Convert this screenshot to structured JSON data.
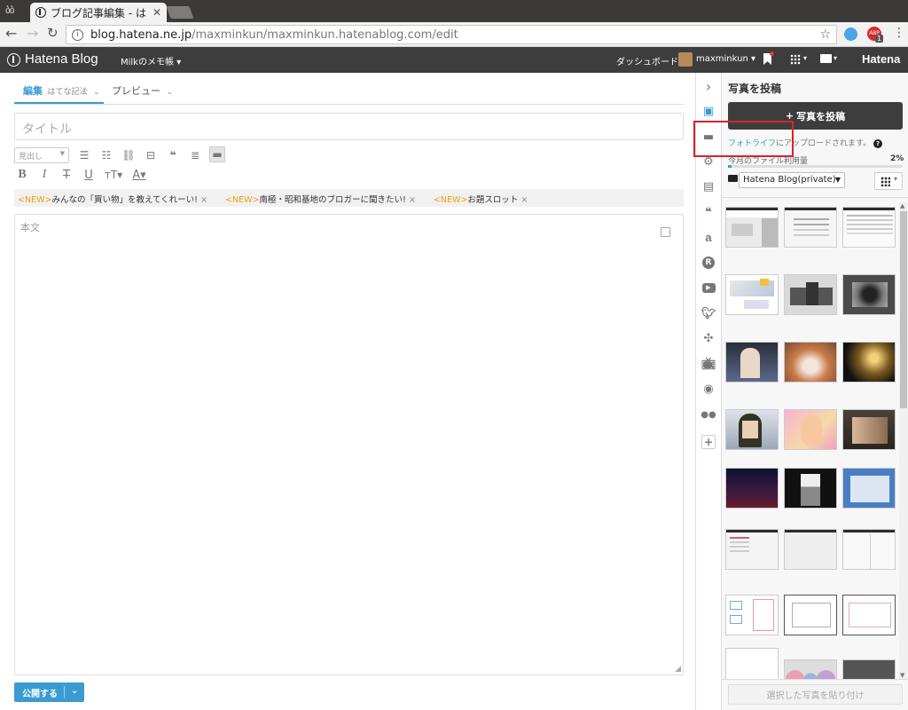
{
  "browser": {
    "tab_title": "ブログ記事編集 - は",
    "url_domain": "blog.hatena.ne.jp",
    "url_path": "/maxminkun/maxminkun.hatenablog.com/edit",
    "ext_badge": "1",
    "ext_abp": "ABP"
  },
  "header": {
    "logo": "Hatena Blog",
    "blog_menu": "Milkのメモ帳 ▾",
    "dashboard": "ダッシュボード",
    "username": "maxminkun ▾",
    "hatena": "Hatena"
  },
  "editor": {
    "tab_edit": "編集",
    "tab_edit_mode": "はてな記法",
    "tab_preview": "プレビュー",
    "title_placeholder": "タイトル",
    "heading_select": "見出し",
    "body_placeholder": "本文",
    "topics": [
      {
        "tag": "<NEW>",
        "text": "みんなの「買い物」を教えてくれーい!"
      },
      {
        "tag": "<NEW>",
        "text": "南極・昭和基地のブロガーに聞きたい!"
      },
      {
        "tag": "<NEW>",
        "text": "お題スロット"
      }
    ],
    "publish_button": "公開する"
  },
  "panel": {
    "title": "写真を投稿",
    "upload_button": "写真を投稿",
    "fotolife_link": "フォトライフ",
    "fotolife_text": "にアップロードされます。",
    "usage_label": "今月のファイル利用量",
    "usage_value": "2%",
    "usage_fraction": 0.02,
    "folder": "Hatena Blog(private)",
    "paste_button": "選択した写真を貼り付け"
  },
  "colors": {
    "accent": "#3b9bd1",
    "header_bg": "#3d3d3d",
    "highlight_box": "#d9232b",
    "new_tag": "#f39c12"
  }
}
